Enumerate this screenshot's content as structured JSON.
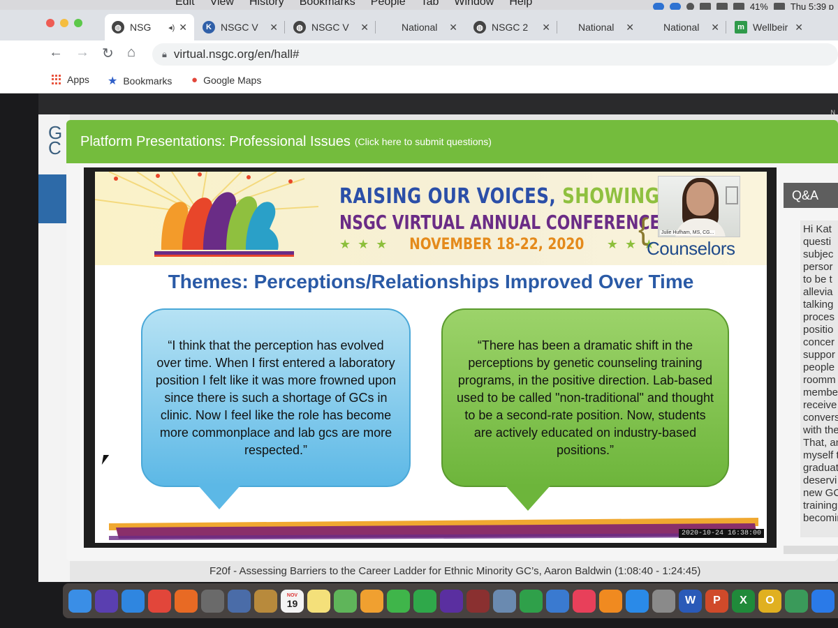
{
  "menubar": {
    "items": [
      "Edit",
      "View",
      "History",
      "Bookmarks",
      "People",
      "Tab",
      "Window",
      "Help"
    ],
    "battery": "41%",
    "clock": "Thu 5:39 p"
  },
  "tabs": [
    {
      "label": "NSG",
      "favicon": "globe-icon",
      "active": true
    },
    {
      "label": "NSGC V",
      "favicon": "k-icon"
    },
    {
      "label": "NSGC V",
      "favicon": "globe-icon"
    },
    {
      "label": "National",
      "favicon": "none"
    },
    {
      "label": "NSGC 2",
      "favicon": "globe-icon"
    },
    {
      "label": "National",
      "favicon": "none"
    },
    {
      "label": "National",
      "favicon": "none"
    },
    {
      "label": "Wellbeir",
      "favicon": "m-icon"
    }
  ],
  "address_bar": {
    "url": "virtual.nsgc.org/en/hall#"
  },
  "bookmarks": [
    {
      "label": "Apps",
      "icon": "apps-grid-icon"
    },
    {
      "label": "Bookmarks",
      "icon": "star-icon"
    },
    {
      "label": "Google Maps",
      "icon": "map-pin-icon"
    }
  ],
  "modal": {
    "title": "Platform Presentations: Professional Issues",
    "title_paren": "(Click here to submit questions)"
  },
  "slide": {
    "banner_line1_a": "RAISING OUR VOICES,",
    "banner_line1_b": "SHOWING OUR ST",
    "banner_line2": "NSGC VIRTUAL ANNUAL CONFERENCE",
    "banner_dates": "NOVEMBER 18-22, 2020",
    "banner_brand": "Counselors",
    "speaker_name": "Julie Hufham, MS, CG...",
    "title": "Themes: Perceptions/Relationships Improved Over Time",
    "quote_left": "“I think that the perception has evolved over time. When I first entered a laboratory position I felt like it was more frowned upon since there is such a shortage of GCs in clinic. Now I feel like the role has become more commonplace and lab gcs are more respected.”",
    "quote_right": "“There has been a dramatic shift in the perceptions by genetic counseling training programs, in the positive direction. Lab-based used to be called \"non-traditional\" and thought to be a second-rate position. Now, students are actively educated on industry-based positions.”",
    "timestamp": "2020-10-24 16:38:00"
  },
  "qa": {
    "header": "Q&A",
    "lines": [
      "Hi Kat",
      "questi",
      "subjec",
      "persor",
      "to be t",
      "allevia",
      "talking",
      "proces",
      "positio",
      "concer",
      "suppor",
      "people",
      "roomm",
      "membe",
      "receive",
      "convers",
      "with the",
      "That, an",
      "myself t",
      "graduat",
      "deservi",
      "new GC",
      "training",
      "becomin"
    ]
  },
  "caption": "F20f - Assessing Barriers to the Career Ladder for Ethnic Minority GC’s, Aaron Baldwin (1:08:40 - 1:24:45)",
  "site": {
    "left_text": "G\nC",
    "top_right": "N"
  },
  "dock": [
    {
      "name": "finder-icon",
      "color": "#3a8ee6"
    },
    {
      "name": "siri-icon",
      "color": "#5a3fb0"
    },
    {
      "name": "safari-icon",
      "color": "#2f86e0"
    },
    {
      "name": "chrome-icon",
      "color": "#e2463a"
    },
    {
      "name": "firefox-icon",
      "color": "#e86a24"
    },
    {
      "name": "launchpad-icon",
      "color": "#6a6a6a"
    },
    {
      "name": "photo-booth-icon",
      "color": "#4a6ca8"
    },
    {
      "name": "notes-folder-icon",
      "color": "#b88a3c"
    },
    {
      "name": "calendar-icon",
      "color": "#f4f4f4"
    },
    {
      "name": "stickies-icon",
      "color": "#f4e07a"
    },
    {
      "name": "maps-icon",
      "color": "#5fb55a"
    },
    {
      "name": "photos-icon",
      "color": "#f0a030"
    },
    {
      "name": "messages-icon",
      "color": "#3fb54a"
    },
    {
      "name": "facetime-icon",
      "color": "#2fa84a"
    },
    {
      "name": "imovie-icon",
      "color": "#5a2fa0"
    },
    {
      "name": "photo-icon",
      "color": "#8a3030"
    },
    {
      "name": "preview-icon",
      "color": "#6a8ab0"
    },
    {
      "name": "numbers-icon",
      "color": "#2fa04a"
    },
    {
      "name": "keynote-icon",
      "color": "#3a7ad0"
    },
    {
      "name": "music-icon",
      "color": "#e8405a"
    },
    {
      "name": "books-icon",
      "color": "#f08a20"
    },
    {
      "name": "app-store-icon",
      "color": "#2a8ae8"
    },
    {
      "name": "settings-icon",
      "color": "#8a8a8a"
    },
    {
      "name": "word-icon",
      "color": "#2a5ab8"
    },
    {
      "name": "powerpoint-icon",
      "color": "#d04a2a"
    },
    {
      "name": "excel-icon",
      "color": "#208a3a"
    },
    {
      "name": "onenote-icon",
      "color": "#e0b020"
    },
    {
      "name": "globe-app-icon",
      "color": "#3a9a5a"
    },
    {
      "name": "zoom-icon",
      "color": "#2a7ae8"
    },
    {
      "name": "spotify-icon",
      "color": "#1ed760"
    }
  ],
  "dock_labels": {
    "calendar_month": "NOV",
    "calendar_day": "19",
    "word": "W",
    "powerpoint": "P",
    "excel": "X",
    "onenote": "O"
  },
  "colors": {
    "header_green": "#74bc3d",
    "bubble_blue": "#5cb8e6",
    "bubble_green": "#6db53b",
    "slide_title_blue": "#2a5aa6"
  }
}
